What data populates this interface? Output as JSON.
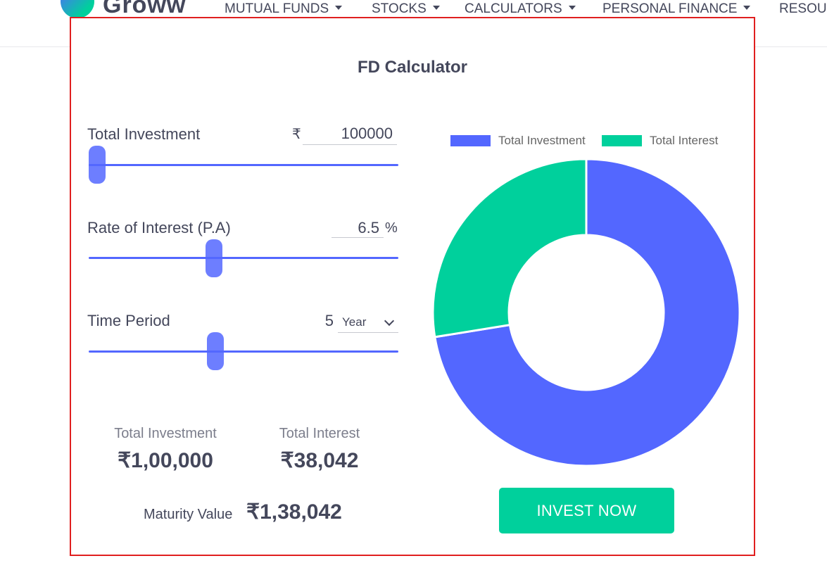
{
  "brand": {
    "name": "Groww"
  },
  "nav": {
    "items": [
      "MUTUAL FUNDS",
      "STOCKS",
      "CALCULATORS",
      "PERSONAL FINANCE",
      "RESOU"
    ]
  },
  "calculator": {
    "title": "FD Calculator",
    "investment": {
      "label": "Total Investment",
      "currency": "₹",
      "value": "100000",
      "slider_fraction": 0.0
    },
    "rate": {
      "label": "Rate of Interest (P.A)",
      "value": "6.5",
      "unit": "%",
      "slider_fraction": 0.4
    },
    "period": {
      "label": "Time Period",
      "value": "5",
      "unit_selected": "Year",
      "slider_fraction": 0.405
    },
    "summary": {
      "investment_label": "Total Investment",
      "investment_value": "₹1,00,000",
      "interest_label": "Total Interest",
      "interest_value": "₹38,042",
      "maturity_label": "Maturity Value",
      "maturity_value": "₹1,38,042"
    },
    "cta": "INVEST NOW"
  },
  "chart_data": {
    "type": "pie",
    "variant": "donut",
    "legend": [
      "Total Investment",
      "Total Interest"
    ],
    "values": [
      100000,
      38042
    ],
    "colors": [
      "#5367ff",
      "#00d09c"
    ],
    "legend_position": "top"
  }
}
